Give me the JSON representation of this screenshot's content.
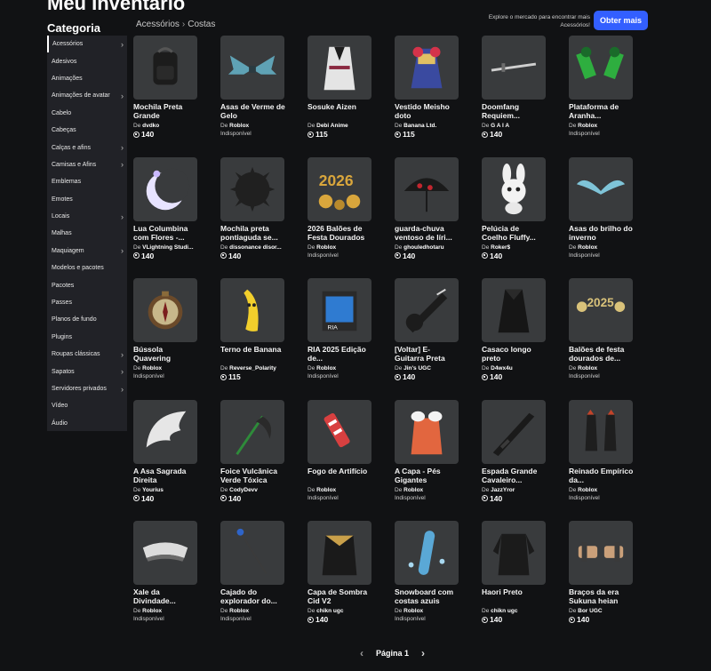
{
  "page": {
    "title": "Meu Inventário",
    "category_heading": "Categoria",
    "breadcrumb": [
      "Acessórios",
      "Costas"
    ],
    "market_text": "Explore o mercado para encontrar mais Acessórios!",
    "get_more": "Obter mais",
    "pager_label": "Página 1"
  },
  "sidebar": [
    {
      "label": "Acessórios",
      "chev": true,
      "active": true
    },
    {
      "label": "Adesivos",
      "chev": false
    },
    {
      "label": "Animações",
      "chev": false
    },
    {
      "label": "Animações de avatar",
      "chev": true
    },
    {
      "label": "Cabelo",
      "chev": false
    },
    {
      "label": "Cabeças",
      "chev": false
    },
    {
      "label": "Calças e afins",
      "chev": true
    },
    {
      "label": "Camisas e Afins",
      "chev": true
    },
    {
      "label": "Emblemas",
      "chev": false
    },
    {
      "label": "Emotes",
      "chev": false
    },
    {
      "label": "Locais",
      "chev": true
    },
    {
      "label": "Malhas",
      "chev": false
    },
    {
      "label": "Maquiagem",
      "chev": true
    },
    {
      "label": "Modelos e pacotes",
      "chev": false
    },
    {
      "label": "Pacotes",
      "chev": false
    },
    {
      "label": "Passes",
      "chev": false
    },
    {
      "label": "Planos de fundo",
      "chev": false
    },
    {
      "label": "Plugins",
      "chev": false
    },
    {
      "label": "Roupas clássicas",
      "chev": true
    },
    {
      "label": "Sapatos",
      "chev": true
    },
    {
      "label": "Servidores privados",
      "chev": true
    },
    {
      "label": "Vídeo",
      "chev": false
    },
    {
      "label": "Áudio",
      "chev": false
    }
  ],
  "items": [
    {
      "name": "Mochila Preta Grande",
      "creator_prefix": "De",
      "creator": "dvdko",
      "price": "140",
      "unavailable": "",
      "icon": "backpack-icon"
    },
    {
      "name": "Asas de Verme de Gelo",
      "creator_prefix": "De",
      "creator": "Roblox",
      "price": "",
      "unavailable": "Indisponível",
      "icon": "ice-wings-icon"
    },
    {
      "name": "Sosuke Aizen",
      "creator_prefix": "De",
      "creator": "Debi Anime",
      "price": "115",
      "unavailable": "",
      "icon": "robe-icon"
    },
    {
      "name": "Vestido Meisho doto",
      "creator_prefix": "De",
      "creator": "Banana Ltd.",
      "price": "115",
      "unavailable": "",
      "icon": "dress-icon"
    },
    {
      "name": "Doomfang Requiem...",
      "creator_prefix": "De",
      "creator": "G A I A",
      "price": "140",
      "unavailable": "",
      "icon": "sword-icon"
    },
    {
      "name": "Plataforma de Aranha...",
      "creator_prefix": "De",
      "creator": "Roblox",
      "price": "",
      "unavailable": "Indisponível",
      "icon": "spider-platform-icon"
    },
    {
      "name": "Lua Columbina com Flores -...",
      "creator_prefix": "De",
      "creator": "VLightning Studi...",
      "price": "140",
      "unavailable": "",
      "icon": "moon-icon"
    },
    {
      "name": "Mochila preta pontiaguda se...",
      "creator_prefix": "De",
      "creator": "dissonance disor...",
      "price": "140",
      "unavailable": "",
      "icon": "spiky-backpack-icon"
    },
    {
      "name": "2026 Balões de Festa Dourados",
      "creator_prefix": "De",
      "creator": "Roblox",
      "price": "",
      "unavailable": "Indisponível",
      "icon": "balloons-2026-icon"
    },
    {
      "name": "guarda-chuva ventoso de líri...",
      "creator_prefix": "De",
      "creator": "ghouledhotaru",
      "price": "140",
      "unavailable": "",
      "icon": "umbrella-icon"
    },
    {
      "name": "Pelúcia de Coelho Fluffy...",
      "creator_prefix": "De",
      "creator": "Roker$",
      "price": "140",
      "unavailable": "",
      "icon": "bunny-icon"
    },
    {
      "name": "Asas do brilho do inverno",
      "creator_prefix": "De",
      "creator": "Roblox",
      "price": "",
      "unavailable": "Indisponível",
      "icon": "winter-wings-icon"
    },
    {
      "name": "Bússola Quavering",
      "creator_prefix": "De",
      "creator": "Roblox",
      "price": "",
      "unavailable": "Indisponível",
      "icon": "compass-icon"
    },
    {
      "name": "Terno de Banana",
      "creator_prefix": "De",
      "creator": "Reverse_Polarity",
      "price": "115",
      "unavailable": "",
      "icon": "banana-icon"
    },
    {
      "name": "RIA 2025 Edição de...",
      "creator_prefix": "De",
      "creator": "Roblox",
      "price": "",
      "unavailable": "Indisponível",
      "icon": "ria-box-icon"
    },
    {
      "name": "[Voltar] E-Guitarra Preta",
      "creator_prefix": "De",
      "creator": "Jin's UGC",
      "price": "140",
      "unavailable": "",
      "icon": "guitar-icon"
    },
    {
      "name": "Casaco longo preto",
      "creator_prefix": "De",
      "creator": "D4wx4u",
      "price": "140",
      "unavailable": "",
      "icon": "coat-icon"
    },
    {
      "name": "Balões de festa dourados de...",
      "creator_prefix": "De",
      "creator": "Roblox",
      "price": "",
      "unavailable": "Indisponível",
      "icon": "balloons-2025-icon"
    },
    {
      "name": "A Asa Sagrada Direita",
      "creator_prefix": "De",
      "creator": "Yourius",
      "price": "140",
      "unavailable": "",
      "icon": "sacred-wing-icon"
    },
    {
      "name": "Foice Vulcânica Verde Tóxica",
      "creator_prefix": "De",
      "creator": "CodyDevv",
      "price": "140",
      "unavailable": "",
      "icon": "scythe-icon"
    },
    {
      "name": "Fogo de Artifício",
      "creator_prefix": "De",
      "creator": "Roblox",
      "price": "",
      "unavailable": "Indisponível",
      "icon": "firework-icon"
    },
    {
      "name": "A Capa - Pés Gigantes",
      "creator_prefix": "De",
      "creator": "Roblox",
      "price": "",
      "unavailable": "Indisponível",
      "icon": "cape-icon"
    },
    {
      "name": "Espada Grande Cavaleiro...",
      "creator_prefix": "De",
      "creator": "JazzYror",
      "price": "140",
      "unavailable": "",
      "icon": "greatsword-icon"
    },
    {
      "name": "Reinado Empírico da...",
      "creator_prefix": "De",
      "creator": "Roblox",
      "price": "",
      "unavailable": "Indisponível",
      "icon": "gauntlets-icon"
    },
    {
      "name": "Xale da Divindade...",
      "creator_prefix": "De",
      "creator": "Roblox",
      "price": "",
      "unavailable": "Indisponível",
      "icon": "shawl-icon"
    },
    {
      "name": "Cajado do explorador do...",
      "creator_prefix": "De",
      "creator": "Roblox",
      "price": "",
      "unavailable": "Indisponível",
      "icon": "staff-icon"
    },
    {
      "name": "Capa de Sombra Cid V2",
      "creator_prefix": "De",
      "creator": "chikn ugc",
      "price": "140",
      "unavailable": "",
      "icon": "shadow-cape-icon"
    },
    {
      "name": "Snowboard com costas azuis",
      "creator_prefix": "De",
      "creator": "Roblox",
      "price": "",
      "unavailable": "Indisponível",
      "icon": "snowboard-icon"
    },
    {
      "name": "Haori Preto",
      "creator_prefix": "De",
      "creator": "chikn ugc",
      "price": "140",
      "unavailable": "",
      "icon": "haori-icon"
    },
    {
      "name": "Braços da era Sukuna heian",
      "creator_prefix": "De",
      "creator": "Bor UGC",
      "price": "140",
      "unavailable": "",
      "icon": "arms-icon"
    }
  ]
}
